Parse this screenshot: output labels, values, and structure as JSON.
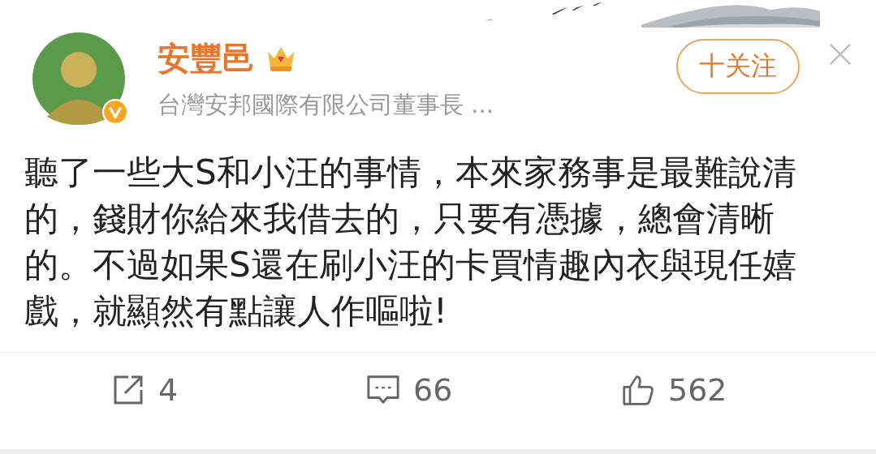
{
  "author": {
    "name": "安豐邑",
    "verified": true,
    "bio": "台灣安邦國際有限公司董事長 ..."
  },
  "follow_button": {
    "label": "十关注"
  },
  "post": {
    "text": "聽了一些大S和小汪的事情，本來家務事是最難說清的，錢財你給來我借去的，只要有憑據，總會清晰的。不過如果S還在刷小汪的卡買情趣內衣與現任嬉戲，就顯然有點讓人作嘔啦!"
  },
  "actions": [
    {
      "kind": "share",
      "count": "4"
    },
    {
      "kind": "comment",
      "count": "66"
    },
    {
      "kind": "like",
      "count": "562"
    }
  ]
}
